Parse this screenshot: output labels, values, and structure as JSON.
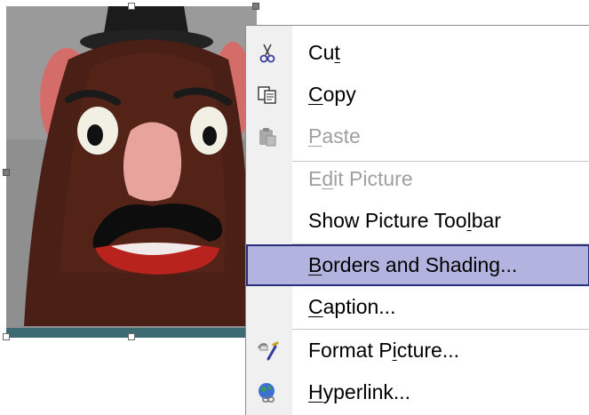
{
  "menu": {
    "items": [
      {
        "key": "cut",
        "pre": "Cu",
        "acc": "t",
        "post": "",
        "icon": "scissors-icon",
        "enabled": true,
        "selected": false
      },
      {
        "key": "copy",
        "pre": "",
        "acc": "C",
        "post": "opy",
        "icon": "copy-icon",
        "enabled": true,
        "selected": false
      },
      {
        "key": "paste",
        "pre": "",
        "acc": "P",
        "post": "aste",
        "icon": "clipboard-icon",
        "enabled": false,
        "selected": false
      },
      {
        "key": "edit_picture",
        "pre": "E",
        "acc": "d",
        "post": "it Picture",
        "icon": "",
        "enabled": false,
        "selected": false
      },
      {
        "key": "show_picture_toolbar",
        "pre": "Show Picture Too",
        "acc": "l",
        "post": "bar",
        "icon": "",
        "enabled": true,
        "selected": false
      },
      {
        "key": "borders_and_shading",
        "pre": "",
        "acc": "B",
        "post": "orders and Shading...",
        "icon": "",
        "enabled": true,
        "selected": true
      },
      {
        "key": "caption",
        "pre": "",
        "acc": "C",
        "post": "aption...",
        "icon": "",
        "enabled": true,
        "selected": false
      },
      {
        "key": "format_picture",
        "pre": "Format P",
        "acc": "i",
        "post": "cture...",
        "icon": "format-brush-icon",
        "enabled": true,
        "selected": false
      },
      {
        "key": "hyperlink",
        "pre": "",
        "acc": "H",
        "post": "yperlink...",
        "icon": "globe-link-icon",
        "enabled": true,
        "selected": false
      }
    ]
  },
  "colors": {
    "selection_fill": "#b2b4df",
    "selection_border": "#2b2c7a",
    "disabled_text": "#a0a0a0"
  }
}
